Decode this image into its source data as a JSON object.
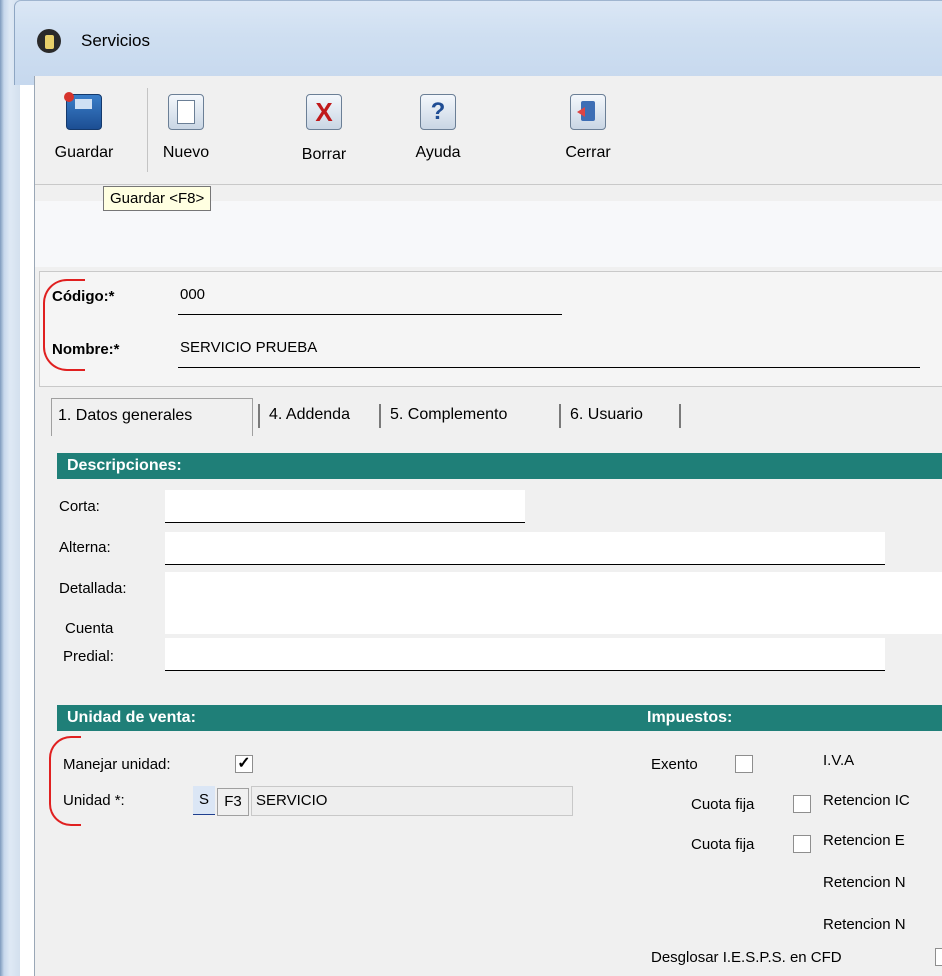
{
  "window": {
    "title": "Servicios"
  },
  "toolbar": {
    "save_label": "Guardar",
    "new_label": "Nuevo",
    "delete_label": "Borrar",
    "help_label": "Ayuda",
    "close_label": "Cerrar",
    "tooltip": "Guardar <F8>"
  },
  "header": {
    "code_label": "Código:*",
    "code_value": "000",
    "name_label": "Nombre:*",
    "name_value": "SERVICIO PRUEBA"
  },
  "tabs": [
    {
      "label": "1. Datos generales",
      "active": true
    },
    {
      "label": "4. Addenda"
    },
    {
      "label": "5. Complemento"
    },
    {
      "label": "6. Usuario"
    }
  ],
  "descripciones": {
    "title": "Descripciones:",
    "corta_label": "Corta:",
    "alterna_label": "Alterna:",
    "detallada_label": "Detallada:",
    "cuenta_label": "Cuenta",
    "predial_label": "Predial:"
  },
  "unidad": {
    "title": "Unidad de venta:",
    "manejar_label": "Manejar unidad:",
    "manejar_checked": true,
    "check_glyph": "✓",
    "unidad_label": "Unidad *:",
    "unidad_code": "S",
    "unidad_key": "F3",
    "unidad_name": "SERVICIO"
  },
  "impuestos": {
    "title": "Impuestos:",
    "exento_label": "Exento",
    "iva_label": "I.V.A",
    "cuota_fija_1": "Cuota fija",
    "retencion_1": "Retencion IC",
    "cuota_fija_2": "Cuota fija",
    "retencion_2": "Retencion E",
    "retencion_3": "Retencion N",
    "retencion_4": "Retencion N",
    "desglosar_label": "Desglosar I.E.S.P.S. en CFD"
  },
  "colors": {
    "section_header": "#1f7f78",
    "highlight_bracket": "#e02020",
    "tooltip_bg": "#ffffe1"
  }
}
